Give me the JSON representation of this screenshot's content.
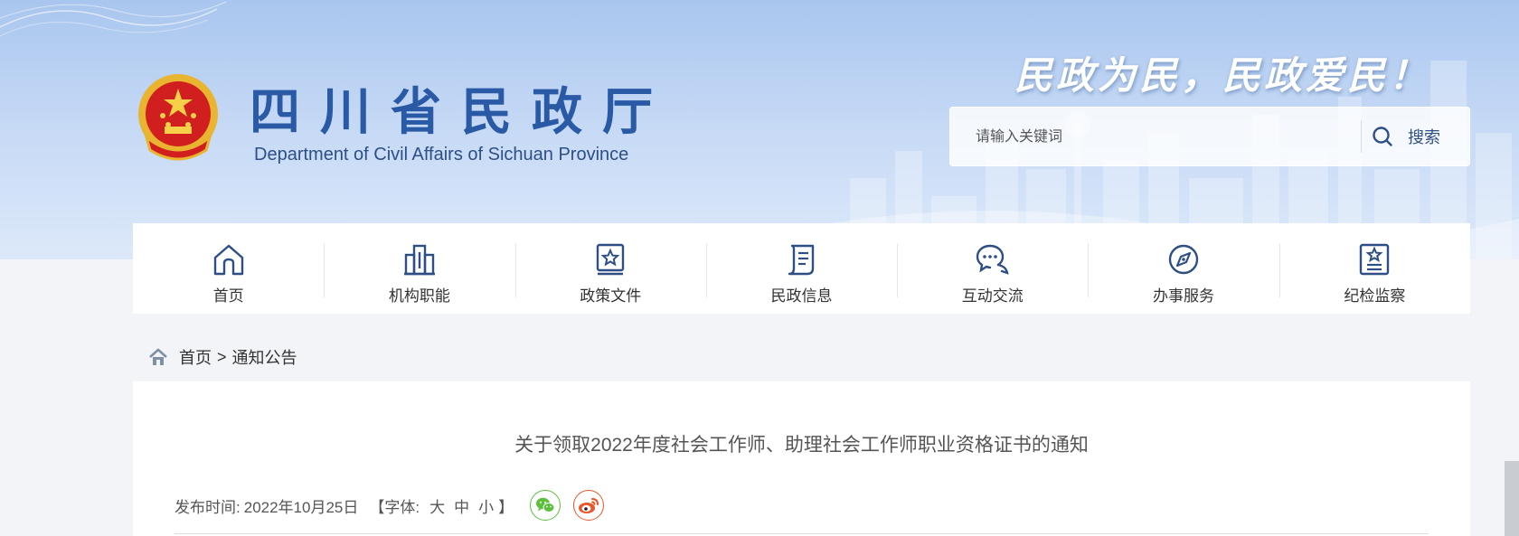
{
  "header": {
    "site_title": "四川省民政厅",
    "site_subtitle": "Department of Civil Affairs of Sichuan Province",
    "slogan": "民政为民，民政爱民！",
    "search": {
      "placeholder": "请输入关键词",
      "button_label": "搜索"
    }
  },
  "nav": {
    "items": [
      {
        "label": "首页",
        "icon": "home-icon"
      },
      {
        "label": "机构职能",
        "icon": "building-icon"
      },
      {
        "label": "政策文件",
        "icon": "document-star-icon"
      },
      {
        "label": "民政信息",
        "icon": "scroll-icon"
      },
      {
        "label": "互动交流",
        "icon": "chat-icon"
      },
      {
        "label": "办事服务",
        "icon": "compass-icon"
      },
      {
        "label": "纪检监察",
        "icon": "badge-star-icon"
      }
    ]
  },
  "breadcrumb": {
    "home": "首页",
    "separator": ">",
    "current": "通知公告"
  },
  "article": {
    "title": "关于领取2022年度社会工作师、助理社会工作师职业资格证书的通知",
    "publish_label": "发布时间:",
    "publish_date": "2022年10月25日",
    "font_prefix": "【字体:",
    "font_large": "大",
    "font_medium": "中",
    "font_small": "小",
    "font_suffix": "】"
  },
  "colors": {
    "brand": "#2a5aa5",
    "nav_icon": "#2d4f86",
    "wechat": "#5cbf3e",
    "weibo": "#e8572a"
  }
}
